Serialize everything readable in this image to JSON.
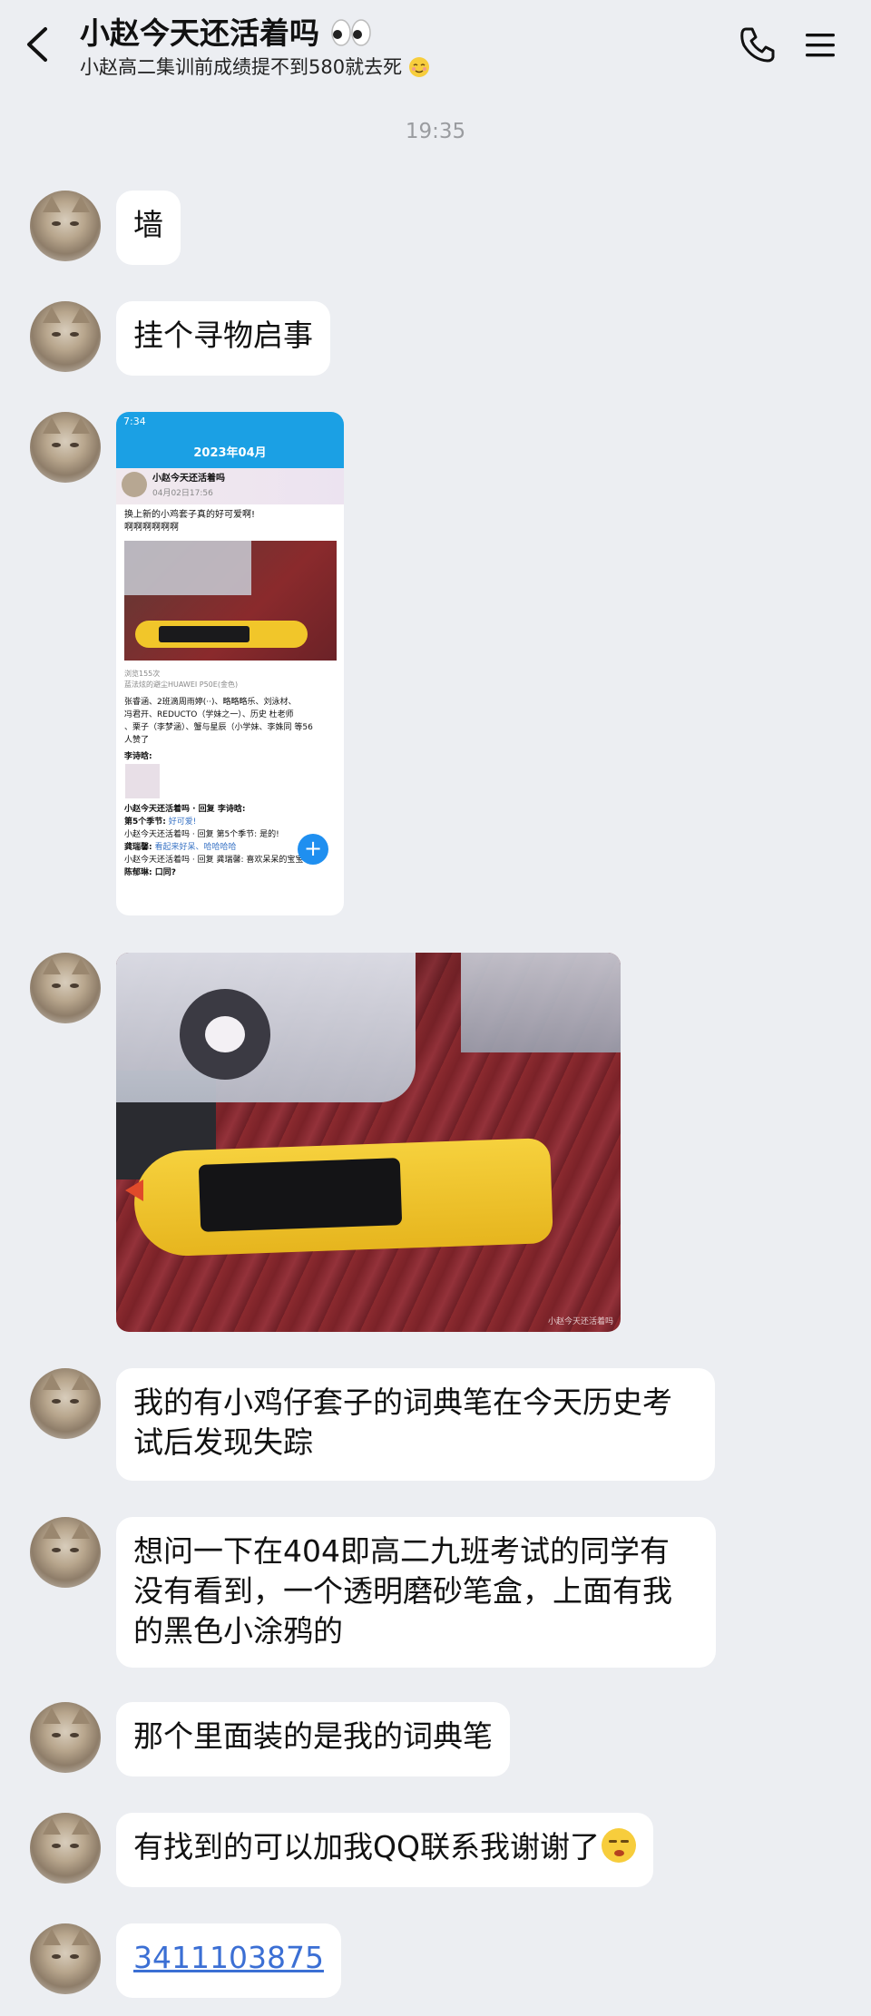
{
  "header": {
    "title": "小赵今天还活着吗",
    "title_icon": "eyes-emoji",
    "subtitle": "小赵高二集训前成绩提不到580就去死",
    "subtitle_icon": "relieved-emoji",
    "back_icon": "chevron-left-icon",
    "call_icon": "phone-icon",
    "menu_icon": "menu-icon"
  },
  "timestamp": "19:35",
  "messages": [
    {
      "text": "墙"
    },
    {
      "text": "挂个寻物启事"
    },
    {
      "text": "我的有小鸡仔套子的词典笔在今天历史考试后发现失踪"
    },
    {
      "text": "想问一下在404即高二九班考试的同学有没有看到，一个透明磨砂笔盒，上面有我的黑色小涂鸦的"
    },
    {
      "text": "那个里面装的是我的词典笔"
    },
    {
      "text": "有找到的可以加我QQ联系我谢谢了",
      "emoji": "smirk-emoji"
    },
    {
      "text": "3411103875",
      "is_link": true
    }
  ],
  "screenshot_image": {
    "status_time": "7:34",
    "nav_title": "2023年04月",
    "post_author": "小赵今天还活着吗",
    "post_date": "04月02日17:56",
    "post_text_1": "换上新的小鸡套子真的好可爱啊!",
    "post_text_2": "啊啊啊啊啊啊",
    "views": "浏览155次",
    "device": "蓝法炫的避尘HUAWEI P50E(金色)",
    "likes_1": "张睿涵、2班滴周雨婷(··)、略略略乐、刘泳材、",
    "likes_2": "冯君开、REDUCTO（学妹之一）、历史 杜老师",
    "likes_3": "、栗子（李梦涵）、蟹与星辰（小学妹、李姝同 等56",
    "likes_4": "人赞了",
    "commenter": "李诗晗:",
    "reply_1": "小赵今天还活着吗 · 回复 李诗晗:",
    "reply_2a": "第5个季节:",
    "reply_2b": "好可爱!",
    "reply_3": "小赵今天还活着吗 · 回复 第5个季节: 是的!",
    "reply_4a": "龚瑞馨:",
    "reply_4b": "看起来好呆、哈哈哈哈",
    "reply_5": "小赵今天还活着吗 · 回复 龚瑞馨: 喜欢呆呆的宝宝",
    "reply_6": "陈郁琳: 口同?"
  },
  "photo": {
    "watermark": "小赵今天还活着吗"
  }
}
